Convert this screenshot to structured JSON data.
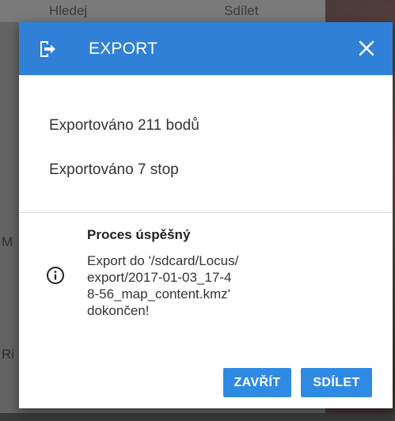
{
  "background": {
    "tabs": [
      "Hledej",
      "Sdílet"
    ],
    "side_texts": [
      "M",
      "Ri"
    ]
  },
  "dialog": {
    "title": "EXPORT",
    "header_icon": "export-icon",
    "close_icon": "close-icon",
    "summary": [
      "Exportováno 211 bodů",
      "Exportováno 7 stop"
    ],
    "result": {
      "icon": "info-icon",
      "title": "Proces úspěšný",
      "message": "Export do '/sdcard/Locus/\nexport/2017-01-03_17-4\n8-56_map_content.kmz'\ndokončen!"
    },
    "buttons": {
      "close_label": "ZAVŘÍT",
      "share_label": "SDÍLET"
    }
  },
  "colors": {
    "accent": "#2f80d6",
    "button": "#2f8ae4"
  }
}
